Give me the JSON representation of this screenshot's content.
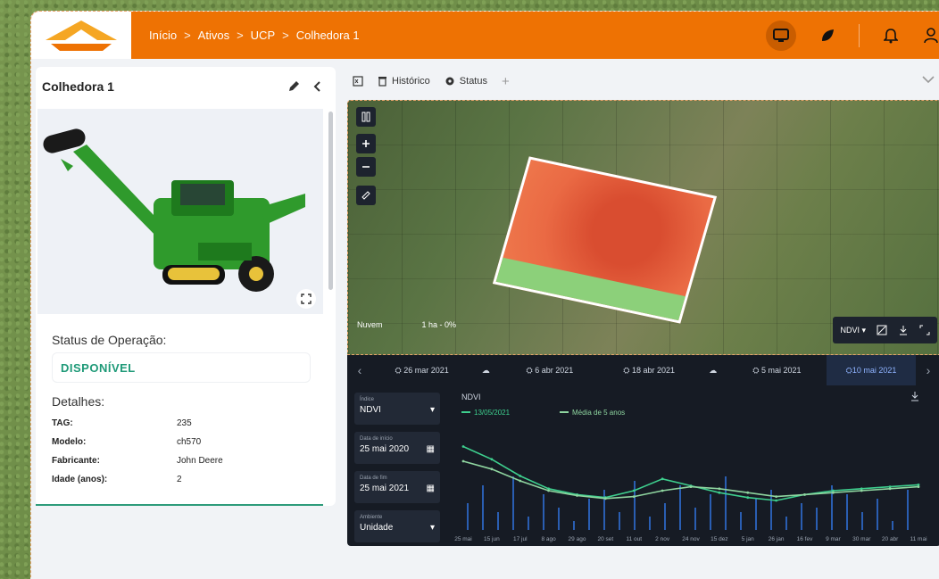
{
  "header": {
    "breadcrumb": [
      "Início",
      "Ativos",
      "UCP",
      "Colhedora 1"
    ],
    "separator": ">"
  },
  "colors": {
    "brand_orange": "#ee7203",
    "status_green": "#1f9a78",
    "dark_panel": "#161b24"
  },
  "left_panel": {
    "title": "Colhedora 1",
    "status_label": "Status de Operação:",
    "status_value": "DISPONÍVEL",
    "details_label": "Detalhes:",
    "details": [
      {
        "key": "TAG:",
        "value": "235"
      },
      {
        "key": "Modelo:",
        "value": "ch570"
      },
      {
        "key": "Fabricante:",
        "value": "John Deere"
      },
      {
        "key": "Idade (anos):",
        "value": "2"
      }
    ]
  },
  "tabs": {
    "historico": "Histórico",
    "status": "Status",
    "add": "+"
  },
  "map": {
    "nuvem_label": "Nuvem",
    "area_label": "1 ha - 0%",
    "layer_select": "NDVI"
  },
  "dates": {
    "items": [
      "26 mar 2021",
      "6 abr 2021",
      "18 abr 2021",
      "5 mai 2021",
      "10 mai 2021"
    ],
    "selected_index": 4
  },
  "chart_controls": {
    "index_label": "Índice",
    "index_value": "NDVI",
    "start_label": "Data de início",
    "start_value": "25 mai 2020",
    "end_label": "Data de fim",
    "end_value": "25 mai 2021",
    "group_label": "Ambiente",
    "group_value": "Unidade"
  },
  "chart_data": {
    "type": "line",
    "title": "NDVI",
    "x": [
      "25 mai",
      "15 jun",
      "17 jul",
      "8 ago",
      "29 ago",
      "20 set",
      "11 out",
      "2 nov",
      "24 nov",
      "15 dez",
      "5 jan",
      "26 jan",
      "16 fev",
      "9 mar",
      "30 mar",
      "20 abr",
      "11 mai"
    ],
    "series": [
      {
        "name": "13/05/2021",
        "values": [
          0.85,
          0.72,
          0.55,
          0.42,
          0.36,
          0.33,
          0.4,
          0.52,
          0.45,
          0.38,
          0.33,
          0.3,
          0.36,
          0.4,
          0.42,
          0.44,
          0.46
        ]
      },
      {
        "name": "Média de 5 anos",
        "values": [
          0.7,
          0.62,
          0.5,
          0.4,
          0.35,
          0.32,
          0.34,
          0.4,
          0.44,
          0.42,
          0.38,
          0.34,
          0.36,
          0.38,
          0.4,
          0.42,
          0.44
        ]
      }
    ],
    "ylim": [
      0,
      1
    ],
    "grid": false,
    "legend": "top"
  }
}
